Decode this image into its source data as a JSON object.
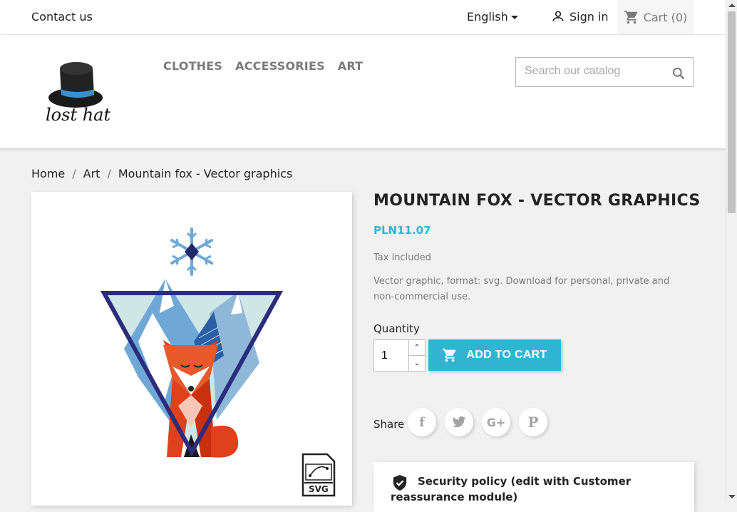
{
  "topbar": {
    "contact_label": "Contact us",
    "language": "English",
    "signin_label": "Sign in",
    "cart_label": "Cart (0)"
  },
  "header": {
    "logo_text": "lost hat",
    "menu": [
      "CLOTHES",
      "ACCESSORIES",
      "ART"
    ],
    "search_placeholder": "Search our catalog"
  },
  "breadcrumb": [
    "Home",
    "Art",
    "Mountain fox - Vector graphics"
  ],
  "product": {
    "title": "MOUNTAIN FOX - VECTOR GRAPHICS",
    "price": "PLN11.07",
    "tax_note": "Tax included",
    "description": "Vector graphic, format: svg. Download for personal, private and non-commercial use.",
    "quantity_label": "Quantity",
    "quantity_value": "1",
    "add_to_cart_label": "ADD TO CART",
    "share_label": "Share",
    "image_badge": "SVG"
  },
  "reassurance": {
    "text": "Security policy (edit with Customer reassurance module)"
  },
  "colors": {
    "accent": "#2fb5d2",
    "text": "#232323",
    "muted": "#7a7a7a",
    "page_bg": "#f1f1f1"
  }
}
